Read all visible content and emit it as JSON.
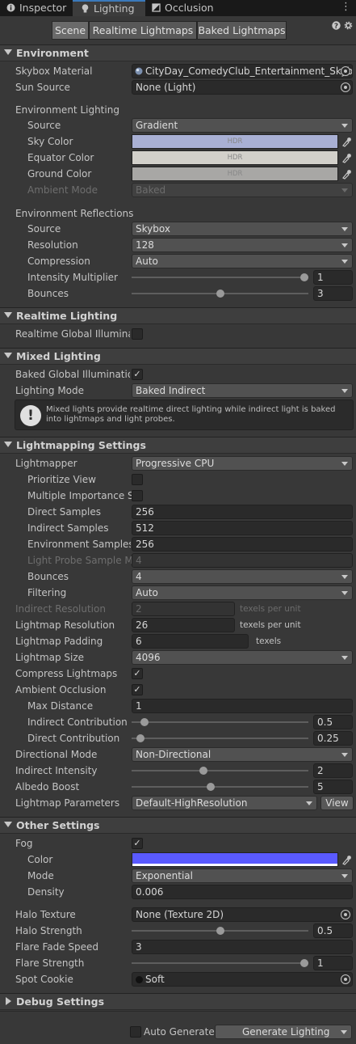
{
  "tabs": [
    {
      "label": "Inspector",
      "icon": "info-icon"
    },
    {
      "label": "Lighting",
      "icon": "bulb-icon"
    },
    {
      "label": "Occlusion",
      "icon": "occlusion-icon"
    }
  ],
  "toolbar": {
    "scene": "Scene",
    "realtime_lightmaps": "Realtime Lightmaps",
    "baked_lightmaps": "Baked Lightmaps",
    "help_icon": "help-icon",
    "settings_icon": "gear-icon"
  },
  "environment": {
    "title": "Environment",
    "skybox_label": "Skybox Material",
    "skybox_value": "CityDay_ComedyClub_Entertainment_Skyb",
    "sun_label": "Sun Source",
    "sun_value": "None (Light)",
    "lighting_header": "Environment Lighting",
    "source_label": "Source",
    "source_value": "Gradient",
    "sky_label": "Sky Color",
    "equator_label": "Equator Color",
    "ground_label": "Ground Color",
    "hdr": "HDR",
    "sky_color": "#a9b0d4",
    "equator_color": "#d2d0ca",
    "ground_color": "#a8a7a5",
    "ambient_label": "Ambient Mode",
    "ambient_value": "Baked",
    "refl_header": "Environment Reflections",
    "refl_source_label": "Source",
    "refl_source_value": "Skybox",
    "resolution_label": "Resolution",
    "resolution_value": "128",
    "compression_label": "Compression",
    "compression_value": "Auto",
    "intensity_label": "Intensity Multiplier",
    "intensity_value": "1",
    "bounces_label": "Bounces",
    "bounces_value": "3"
  },
  "realtime": {
    "title": "Realtime Lighting",
    "gi_label": "Realtime Global Illumination",
    "gi_checked": false
  },
  "mixed": {
    "title": "Mixed Lighting",
    "baked_gi_label": "Baked Global Illumination",
    "baked_gi_checked": true,
    "mode_label": "Lighting Mode",
    "mode_value": "Baked Indirect",
    "info": "Mixed lights provide realtime direct lighting while indirect light is baked into lightmaps and light probes."
  },
  "lightmapping": {
    "title": "Lightmapping Settings",
    "lightmapper_label": "Lightmapper",
    "lightmapper_value": "Progressive CPU",
    "prioritize_label": "Prioritize View",
    "prioritize_checked": false,
    "mis_label": "Multiple Importance Sampling",
    "mis_checked": false,
    "direct_samples_label": "Direct Samples",
    "direct_samples_value": "256",
    "indirect_samples_label": "Indirect Samples",
    "indirect_samples_value": "512",
    "env_samples_label": "Environment Samples",
    "env_samples_value": "256",
    "probe_mult_label": "Light Probe Sample Multiplier",
    "probe_mult_value": "4",
    "bounces_label": "Bounces",
    "bounces_value": "4",
    "filtering_label": "Filtering",
    "filtering_value": "Auto",
    "indirect_res_label": "Indirect Resolution",
    "indirect_res_value": "2",
    "texels": "texels per unit",
    "lightmap_res_label": "Lightmap Resolution",
    "lightmap_res_value": "26",
    "padding_label": "Lightmap Padding",
    "padding_value": "6",
    "padding_unit": "texels",
    "size_label": "Lightmap Size",
    "size_value": "4096",
    "compress_label": "Compress Lightmaps",
    "compress_checked": true,
    "ao_label": "Ambient Occlusion",
    "ao_checked": true,
    "max_dist_label": "Max Distance",
    "max_dist_value": "1",
    "indirect_contrib_label": "Indirect Contribution",
    "indirect_contrib_value": "0.5",
    "direct_contrib_label": "Direct Contribution",
    "direct_contrib_value": "0.25",
    "directional_label": "Directional Mode",
    "directional_value": "Non-Directional",
    "indirect_intensity_label": "Indirect Intensity",
    "indirect_intensity_value": "2",
    "albedo_label": "Albedo Boost",
    "albedo_value": "5",
    "params_label": "Lightmap Parameters",
    "params_value": "Default-HighResolution",
    "view_label": "View"
  },
  "other": {
    "title": "Other Settings",
    "fog_label": "Fog",
    "fog_checked": true,
    "color_label": "Color",
    "fog_color": "#5a5aff",
    "mode_label": "Mode",
    "mode_value": "Exponential",
    "density_label": "Density",
    "density_value": "0.006",
    "halo_tex_label": "Halo Texture",
    "halo_tex_value": "None (Texture 2D)",
    "halo_strength_label": "Halo Strength",
    "halo_strength_value": "0.5",
    "flare_fade_label": "Flare Fade Speed",
    "flare_fade_value": "3",
    "flare_strength_label": "Flare Strength",
    "flare_strength_value": "1",
    "spot_cookie_label": "Spot Cookie",
    "spot_cookie_value": "Soft"
  },
  "debug": {
    "title": "Debug Settings"
  },
  "bottom": {
    "auto_label": "Auto Generate",
    "auto_checked": false,
    "generate_label": "Generate Lighting"
  }
}
